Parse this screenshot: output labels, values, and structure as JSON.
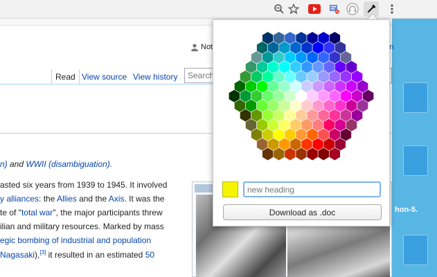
{
  "browser": {
    "icons": [
      "zoom-out-icon",
      "bookmark-star-icon",
      "youtube-extension-icon",
      "rss-extension-icon",
      "headphones-extension-icon",
      "eyedropper-extension-icon",
      "menu-more-icon"
    ]
  },
  "wiki": {
    "user_text": "Not",
    "login_partial": "in",
    "tabs": [
      {
        "label": "Read",
        "active": true
      },
      {
        "label": "View source",
        "active": false
      },
      {
        "label": "View history",
        "active": false
      }
    ],
    "search_placeholder": "Search",
    "hatnote": {
      "prefix": "n)",
      "connector": " and ",
      "link": "WWII (disambiguation)",
      "suffix": "."
    },
    "paragraph": [
      {
        "text": "asted six years from 1939 to 1945. It involved"
      },
      {
        "pre": "",
        "link1": "y alliances",
        "mid": ": the ",
        "link2": "Allies",
        "mid2": " and the ",
        "link3": "Axis",
        "post": ". It was the"
      },
      {
        "pre": "te of \"",
        "link1": "total war",
        "post": "\", the major participants threw"
      },
      {
        "text": "ilian and military resources. Marked by mass"
      },
      {
        "link1": "egic bombing of industrial and population"
      },
      {
        "pre": "",
        "link1": " Nagasaki",
        "mid": "),",
        "sup": "[3]",
        "post": " it resulted in an estimated ",
        "link2": "50"
      }
    ],
    "desktop_label": "hon-5."
  },
  "popup": {
    "swatch_color": "#f4f400",
    "heading_placeholder": "new heading",
    "download_label": "Download as .doc"
  },
  "palette": {
    "rows": [
      [
        "#003366",
        "#336699",
        "#3366cc",
        "#003399",
        "#000099",
        "#0000cc",
        "#000066"
      ],
      [
        "#006666",
        "#006699",
        "#0099cc",
        "#0066cc",
        "#0033cc",
        "#0000ff",
        "#3333ff",
        "#333399"
      ],
      [
        "#669999",
        "#009999",
        "#33cccc",
        "#00ccff",
        "#0099ff",
        "#0066ff",
        "#3366ff",
        "#3333cc",
        "#666699"
      ],
      [
        "#339966",
        "#00cc99",
        "#00ffcc",
        "#00ffff",
        "#33ccff",
        "#3399ff",
        "#6699ff",
        "#6666ff",
        "#6600ff",
        "#6600cc"
      ],
      [
        "#339933",
        "#00cc66",
        "#00ff99",
        "#66ffcc",
        "#66ffff",
        "#66ccff",
        "#99ccff",
        "#9999ff",
        "#9966ff",
        "#9933ff",
        "#9900ff"
      ],
      [
        "#006600",
        "#00cc00",
        "#00ff00",
        "#66ff99",
        "#99ffcc",
        "#ccffff",
        "#ccccff",
        "#cc99ff",
        "#cc66ff",
        "#cc33ff",
        "#cc00ff",
        "#9900cc"
      ],
      [
        "#003300",
        "#009933",
        "#33cc33",
        "#66ff66",
        "#99ff99",
        "#ccffcc",
        "#ffffff",
        "#ffccff",
        "#ff99ff",
        "#ff66ff",
        "#ff00ff",
        "#cc00cc",
        "#660066"
      ],
      [
        "#336600",
        "#009900",
        "#66ff33",
        "#99ff66",
        "#ccff99",
        "#ffffcc",
        "#ffcccc",
        "#ff99cc",
        "#ff66cc",
        "#ff33cc",
        "#cc0099",
        "#993399"
      ],
      [
        "#333300",
        "#669900",
        "#99ff33",
        "#ccff66",
        "#ffff99",
        "#ffcc99",
        "#ff9999",
        "#ff6699",
        "#ff3399",
        "#cc3399",
        "#990099"
      ],
      [
        "#666633",
        "#99cc00",
        "#ccff33",
        "#ffff66",
        "#ffcc66",
        "#ff9966",
        "#ff7c80",
        "#ff0066",
        "#d60093",
        "#993366"
      ],
      [
        "#808000",
        "#cccc00",
        "#ffff00",
        "#ffcc00",
        "#ff9933",
        "#ff6600",
        "#ff5050",
        "#cc0066",
        "#660033"
      ],
      [
        "#996633",
        "#cc9900",
        "#ff9900",
        "#cc6600",
        "#ff3300",
        "#ff0000",
        "#cc0000",
        "#990033"
      ],
      [
        "#663300",
        "#996600",
        "#cc3300",
        "#993300",
        "#990000",
        "#800000",
        "#a50021"
      ]
    ]
  }
}
